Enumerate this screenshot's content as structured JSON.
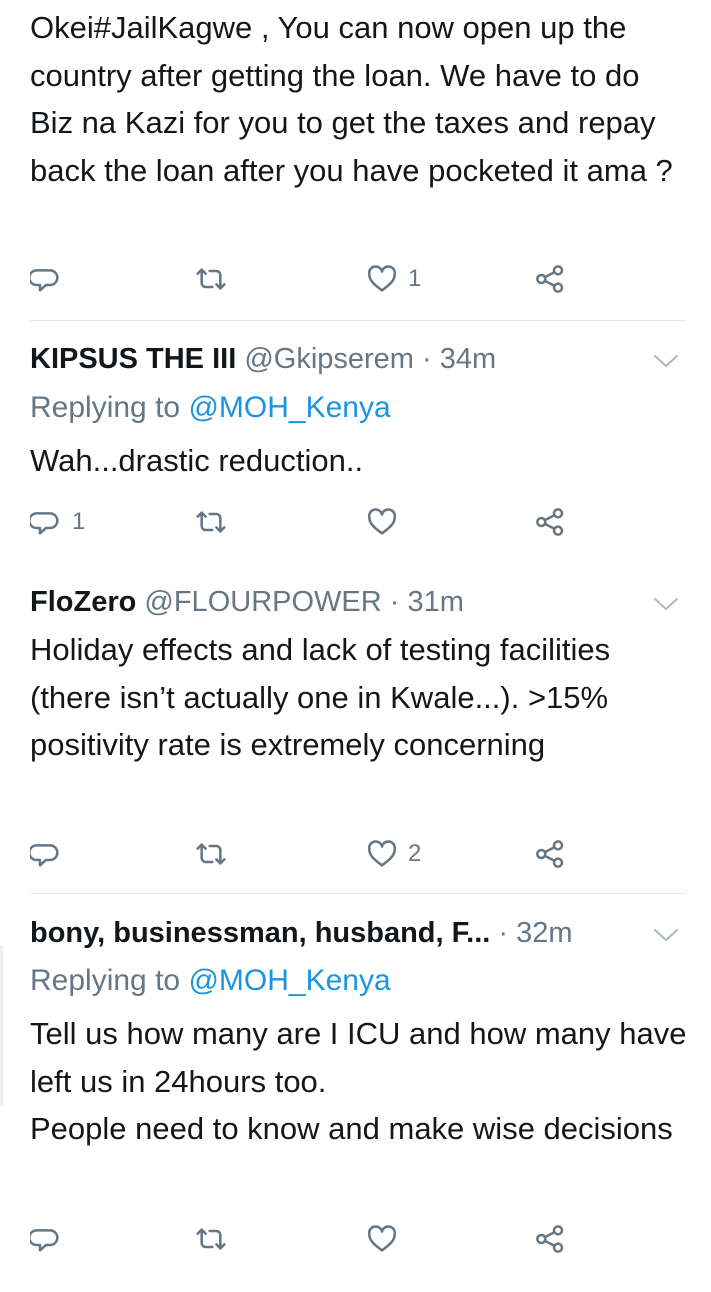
{
  "tweets": [
    {
      "text": "Okei#JailKagwe , You can now open up the country after getting the loan. We have to do Biz na Kazi for you to get the taxes and repay back the loan after you have pocketed it ama ?",
      "reply_count": "",
      "like_count": "1"
    },
    {
      "name": "KIPSUS THE III",
      "handle": "@Gkipserem",
      "time": " · 34m",
      "replying_label": "Replying to ",
      "replying_handle": "@MOH_Kenya",
      "text": "Wah...drastic reduction..",
      "reply_count": "1",
      "like_count": ""
    },
    {
      "name": "FloZero",
      "handle": "@FLOURPOWER",
      "time": " · 31m",
      "text": "Holiday effects and lack of testing facilities (there isn’t actually one in Kwale...). >15% positivity rate is extremely concerning",
      "reply_count": "",
      "like_count": "2"
    },
    {
      "name": "bony, businessman, husband, F...",
      "time": " · 32m",
      "replying_label": "Replying to ",
      "replying_handle": "@MOH_Kenya",
      "text": "Tell us how many are I ICU and how many have left us in 24hours too.\nPeople need to know and make wise decisions",
      "reply_count": "",
      "like_count": ""
    }
  ],
  "icons": {
    "reply": "reply-icon",
    "retweet": "retweet-icon",
    "like": "heart-icon",
    "share": "share-icon",
    "menu": "chevron-down-icon"
  },
  "colors": {
    "text": "#14171a",
    "muted": "#657786",
    "link": "#1b95e0",
    "divider": "#e1e8ed"
  }
}
